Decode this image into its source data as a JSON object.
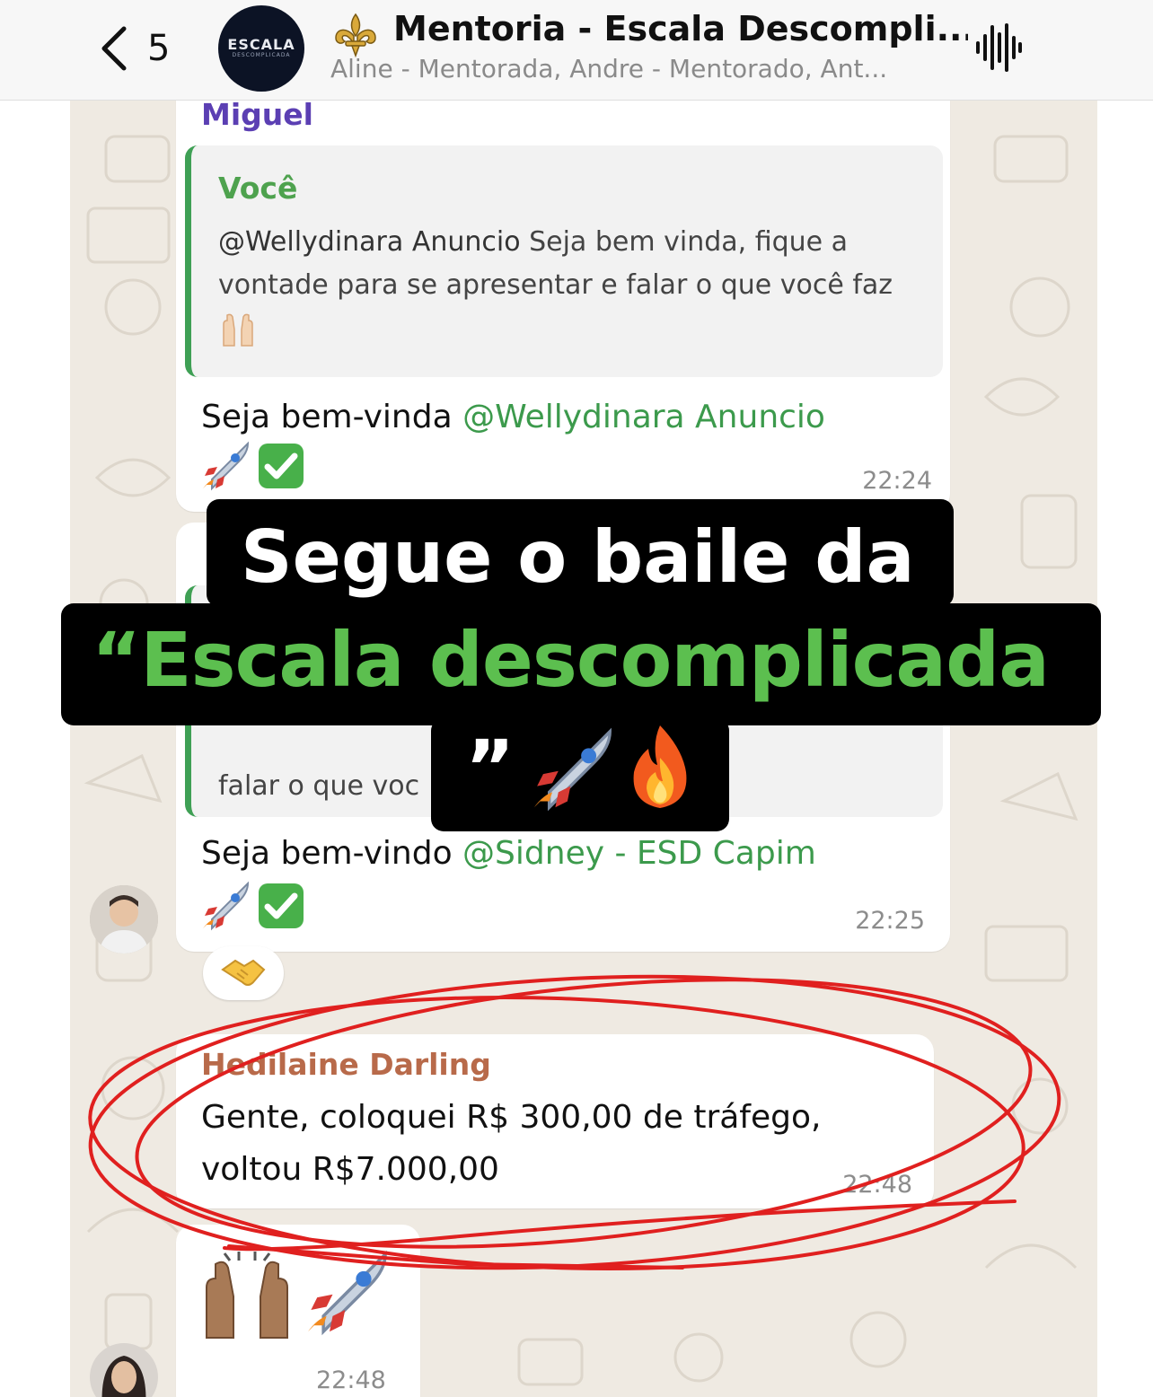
{
  "header": {
    "back_count": "5",
    "group_avatar_line1": "ESCALA",
    "group_avatar_line2": "DESCOMPLICADA",
    "title": "Mentoria - Escala Descompli...",
    "participants": "Aline - Mentorada, Andre - Mentorado, Ant...",
    "icons": [
      "chevron-left-icon",
      "fleur-de-lis-icon",
      "audio-wave-icon"
    ]
  },
  "messages": {
    "m1": {
      "sender": "Miguel",
      "quote_author": "Você",
      "quote_mention": "@Wellydinara Anuncio",
      "quote_text": " Seja bem vinda, fique a vontade para se apresentar e falar o que você faz",
      "text": "Seja bem-vinda ",
      "mention": "@Wellydinara Anuncio",
      "time": "22:24"
    },
    "m2": {
      "quote_text_partial": "falar o que voc",
      "text": "Seja bem-vindo ",
      "mention": "@Sidney - ESD Capim",
      "time": "22:25",
      "reaction": "handshake"
    },
    "m3": {
      "sender": "Hedilaine Darling",
      "line1": "Gente, coloquei R$ 300,00 de tráfego,",
      "line2": "voltou R$7.000,00",
      "time": "22:48"
    },
    "m4": {
      "time": "22:48"
    }
  },
  "caption": {
    "line1": "Segue o baile da",
    "line2": "“Escala descomplicada",
    "line3": "”"
  },
  "colors": {
    "mention_green": "#3c9a4c",
    "caption_green": "#5cbf4f",
    "sender_miguel": "#5b3fb3",
    "sender_hedilaine": "#b86a4a",
    "annotation_red": "#e0201f"
  }
}
